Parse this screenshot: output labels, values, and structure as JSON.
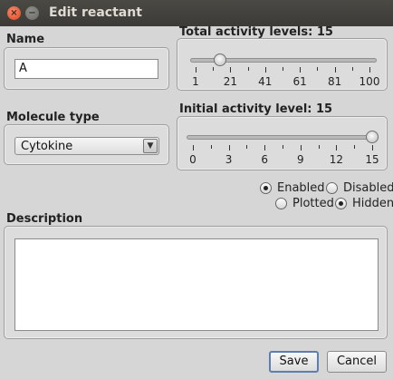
{
  "window": {
    "title": "Edit reactant",
    "close_glyph": "×",
    "minimize_glyph": "−"
  },
  "name": {
    "label": "Name",
    "value": "A"
  },
  "total_levels": {
    "label": "Total activity levels: 15",
    "min": 1,
    "max": 100,
    "value": 15,
    "tick_labels": [
      "1",
      "21",
      "41",
      "61",
      "81",
      "100"
    ]
  },
  "molecule_type": {
    "label": "Molecule type",
    "selected": "Cytokine",
    "arrow_glyph": "▼"
  },
  "initial_level": {
    "label": "Initial activity level: 15",
    "min": 0,
    "max": 15,
    "value": 15,
    "tick_labels": [
      "0",
      "3",
      "6",
      "9",
      "12",
      "15"
    ]
  },
  "state": {
    "enabled_label": "Enabled",
    "disabled_label": "Disabled",
    "selected": "Enabled"
  },
  "visibility": {
    "plotted_label": "Plotted",
    "hidden_label": "Hidden",
    "selected": "Hidden"
  },
  "description": {
    "label": "Description",
    "value": ""
  },
  "buttons": {
    "save": "Save",
    "cancel": "Cancel"
  }
}
